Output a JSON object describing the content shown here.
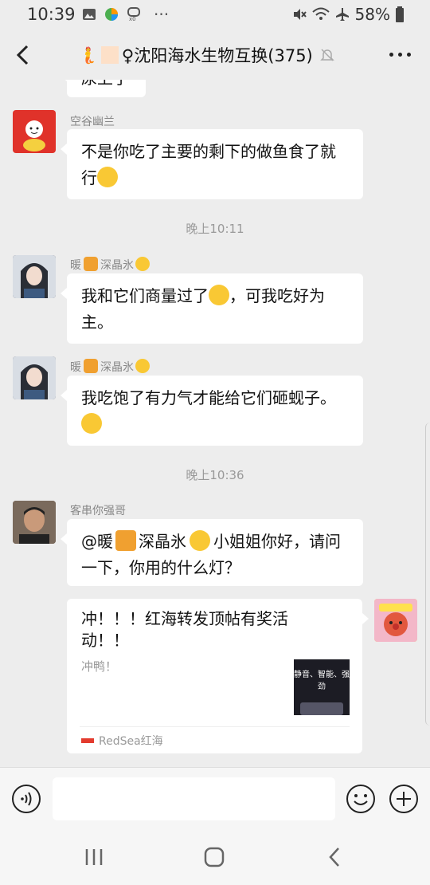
{
  "status_bar": {
    "time": "10:39",
    "battery": "58%"
  },
  "header": {
    "title_prefix_emoji": "🧜",
    "title": "♀沈阳海水生物互换(375)"
  },
  "messages": [
    {
      "partial_text": "尿上了"
    },
    {
      "nick": "空谷幽兰",
      "text": "不是你吃了主要的剩下的做鱼食了就行"
    },
    {
      "time": "晚上10:11"
    },
    {
      "nick_a": "暖",
      "nick_b": "深晶氷",
      "text_a": "我和它们商量过了",
      "text_b": "，可我吃好为主。"
    },
    {
      "nick_a": "暖",
      "nick_b": "深晶氷",
      "text": "我吃饱了有力气才能给它们砸蚬子。"
    },
    {
      "time": "晚上10:36"
    },
    {
      "nick": "客串你强哥",
      "text_a": "@暖",
      "text_b": "深晶氷",
      "text_c": "小姐姐你好，请问一下，你用的什么灯？"
    },
    {
      "card_title": "冲！！！红海转发顶帖有奖活动！！",
      "card_desc": "冲鸭！",
      "card_source": "RedSea红海",
      "card_thumb_text": "静音、智能、强劲"
    }
  ],
  "input": {
    "value": "",
    "placeholder": ""
  },
  "colors": {
    "background": "#ededed",
    "bubble": "#ffffff",
    "accent_red": "#e33b2e"
  }
}
